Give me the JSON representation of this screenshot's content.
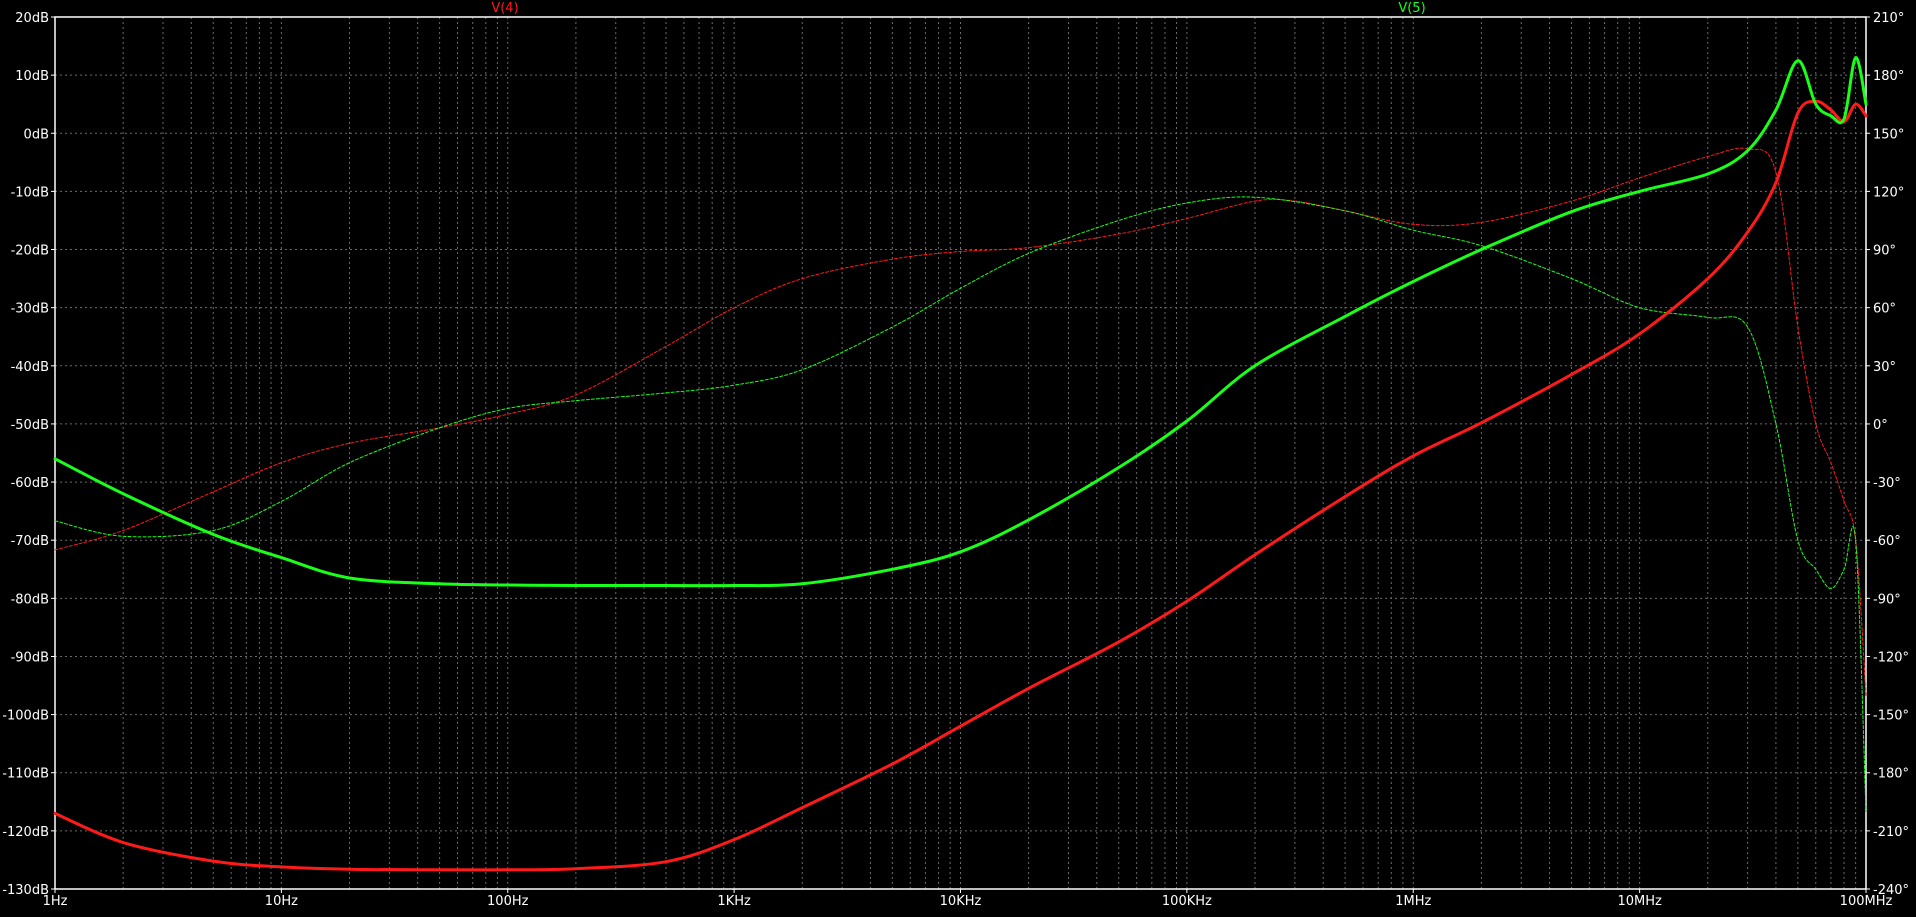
{
  "chart_data": {
    "type": "line",
    "x_scale": "log",
    "xlim": [
      1,
      100000000
    ],
    "x_ticks": [
      "1Hz",
      "10Hz",
      "100Hz",
      "1KHz",
      "10KHz",
      "100KHz",
      "1MHz",
      "10MHz",
      "100MHz"
    ],
    "y_left": {
      "ylim": [
        -130,
        20
      ],
      "ticks": [
        "20dB",
        "10dB",
        "0dB",
        "-10dB",
        "-20dB",
        "-30dB",
        "-40dB",
        "-50dB",
        "-60dB",
        "-70dB",
        "-80dB",
        "-90dB",
        "-100dB",
        "-110dB",
        "-120dB",
        "-130dB"
      ]
    },
    "y_right": {
      "ylim": [
        -240,
        210
      ],
      "ticks": [
        "210°",
        "180°",
        "150°",
        "120°",
        "90°",
        "60°",
        "30°",
        "0°",
        "-30°",
        "-60°",
        "-90°",
        "-120°",
        "-150°",
        "-180°",
        "-210°",
        "-240°"
      ]
    },
    "grid": true,
    "background": "#000000",
    "series": [
      {
        "name": "V(4)",
        "color": "#ff1a1a",
        "kind": "magnitude",
        "axis": "left",
        "x": [
          1,
          2,
          5,
          10,
          20,
          50,
          100,
          200,
          500,
          1000,
          2000,
          5000,
          10000,
          20000,
          50000,
          100000,
          200000,
          500000,
          1000000,
          2000000,
          5000000,
          10000000,
          20000000,
          30000000,
          40000000,
          50000000,
          60000000,
          70000000,
          80000000,
          90000000,
          100000000
        ],
        "y": [
          -117,
          -122,
          -125.2,
          -126.2,
          -126.6,
          -126.7,
          -126.7,
          -126.5,
          -125.3,
          -121.5,
          -116,
          -108.5,
          -102,
          -95.5,
          -87.5,
          -80.5,
          -72.5,
          -62.5,
          -55.5,
          -49.8,
          -41.5,
          -34.5,
          -25,
          -17,
          -8.5,
          3.5,
          5.5,
          4,
          2,
          5,
          3
        ]
      },
      {
        "name": "V(4)",
        "color": "#ff1a1a",
        "kind": "phase",
        "axis": "right",
        "x": [
          1,
          2,
          5,
          10,
          20,
          50,
          100,
          200,
          500,
          1000,
          2000,
          5000,
          10000,
          20000,
          50000,
          100000,
          200000,
          300000,
          500000,
          1000000,
          2000000,
          5000000,
          10000000,
          20000000,
          30000000,
          40000000,
          50000000,
          60000000,
          70000000,
          80000000,
          90000000,
          100000000
        ],
        "y": [
          -65,
          -55,
          -35,
          -20,
          -10,
          -2,
          5,
          15,
          40,
          60,
          75,
          85,
          89,
          91,
          98,
          106,
          115,
          115,
          110,
          103,
          104,
          115,
          127,
          138,
          142,
          130,
          50,
          0,
          -20,
          -40,
          -60,
          -140
        ]
      },
      {
        "name": "V(5)",
        "color": "#1aff1a",
        "kind": "magnitude",
        "axis": "left",
        "x": [
          1,
          2,
          5,
          10,
          20,
          50,
          100,
          200,
          500,
          1000,
          2000,
          5000,
          10000,
          20000,
          50000,
          100000,
          200000,
          500000,
          1000000,
          2000000,
          5000000,
          10000000,
          20000000,
          30000000,
          40000000,
          50000000,
          60000000,
          70000000,
          80000000,
          90000000,
          100000000
        ],
        "y": [
          -56,
          -62,
          -69,
          -73,
          -76.5,
          -77.5,
          -77.7,
          -77.8,
          -77.8,
          -77.8,
          -77.5,
          -75,
          -72,
          -66.5,
          -57.5,
          -49.5,
          -40,
          -31.5,
          -25.5,
          -20,
          -13.5,
          -10,
          -7,
          -3,
          4,
          12.5,
          5,
          3,
          2.5,
          13,
          5
        ]
      },
      {
        "name": "V(5)",
        "color": "#1aff1a",
        "kind": "phase",
        "axis": "right",
        "x": [
          1,
          2,
          5,
          10,
          20,
          50,
          100,
          200,
          500,
          1000,
          2000,
          5000,
          10000,
          20000,
          50000,
          100000,
          200000,
          500000,
          1000000,
          2000000,
          5000000,
          10000000,
          20000000,
          30000000,
          40000000,
          50000000,
          60000000,
          70000000,
          80000000,
          90000000,
          100000000
        ],
        "y": [
          -50,
          -58,
          -55,
          -40,
          -20,
          -2,
          8,
          12,
          16,
          20,
          28,
          50,
          70,
          88,
          105,
          114,
          117,
          110,
          100,
          92,
          75,
          60,
          55,
          50,
          0,
          -60,
          -75,
          -85,
          -75,
          -60,
          -200
        ]
      }
    ]
  }
}
